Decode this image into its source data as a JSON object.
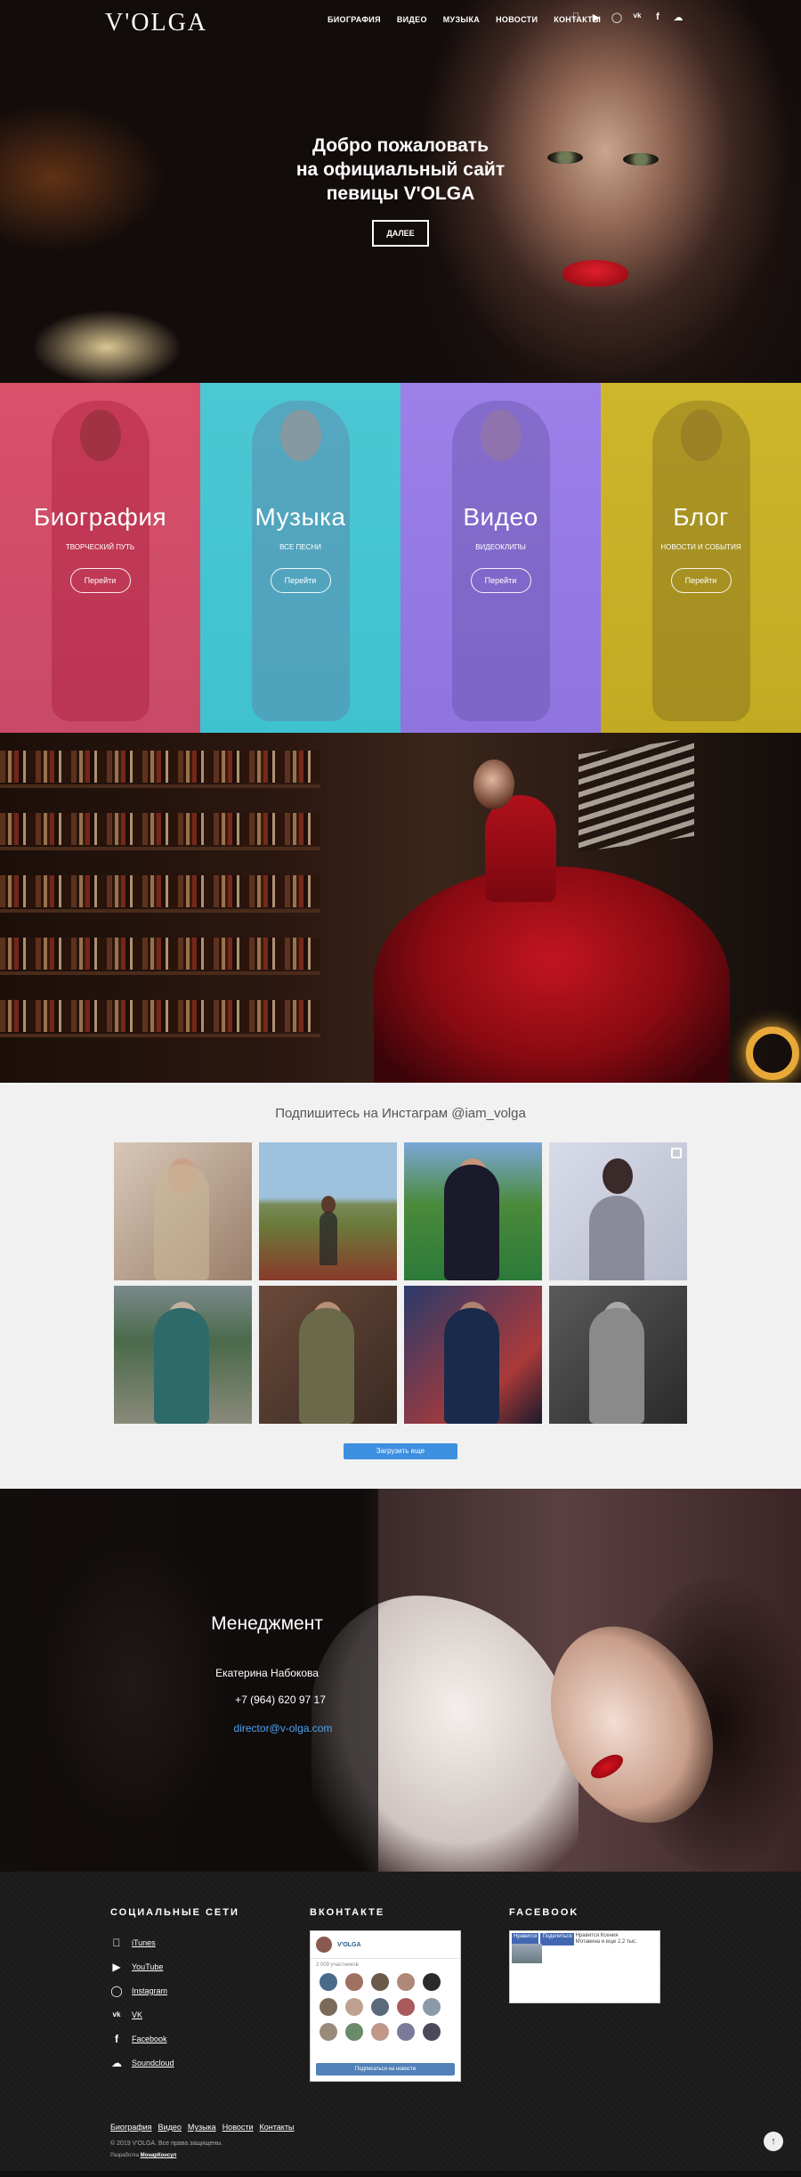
{
  "header": {
    "logo": "V'OLGA",
    "menu": [
      "БИОГРАФИЯ",
      "ВИДЕО",
      "МУЗЫКА",
      "НОВОСТИ",
      "КОНТАКТЫ"
    ],
    "social_icons": [
      "apple-icon",
      "youtube-icon",
      "instagram-icon",
      "vk-icon",
      "facebook-icon",
      "soundcloud-icon"
    ]
  },
  "hero": {
    "title_line1": "Добро пожаловать",
    "title_line2": "на официальный сайт",
    "title_line3": "певицы V'OLGA",
    "button": "ДАЛЕЕ"
  },
  "tiles": [
    {
      "title": "Биография",
      "subtitle": "ТВОРЧЕСКИЙ ПУТЬ",
      "button": "Перейти",
      "color": "#d8506a"
    },
    {
      "title": "Музыка",
      "subtitle": "ВСЕ ПЕСНИ",
      "button": "Перейти",
      "color": "#44c8d4"
    },
    {
      "title": "Видео",
      "subtitle": "ВИДЕОКЛИПЫ",
      "button": "Перейти",
      "color": "#9a7ee6"
    },
    {
      "title": "Блог",
      "subtitle": "НОВОСТИ И СОБЫТИЯ",
      "button": "Перейти",
      "color": "#cdb52a"
    }
  ],
  "instagram": {
    "heading": "Подпишитесь на Инстаграм @iam_volga",
    "load_more": "Загрузить еще"
  },
  "management": {
    "heading": "Менеджмент",
    "name": "Екатерина Набокова",
    "phone": "+7 (964) 620 97 17",
    "email": "director@v-olga.com"
  },
  "footer": {
    "social_heading": "СОЦИАЛЬНЫЕ СЕТИ",
    "social": [
      {
        "icon": "apple-icon",
        "label": "iTunes"
      },
      {
        "icon": "youtube-icon",
        "label": "YouTube"
      },
      {
        "icon": "instagram-icon",
        "label": "Instagram"
      },
      {
        "icon": "vk-icon",
        "label": "VK"
      },
      {
        "icon": "facebook-icon",
        "label": "Facebook"
      },
      {
        "icon": "soundcloud-icon",
        "label": "Soundcloud"
      }
    ],
    "vk_heading": "ВКОНТАКТЕ",
    "vk_widget": {
      "name": "V'OLGA",
      "count": "2 009 участников",
      "subscribe": "Подписаться на новости"
    },
    "fb_heading": "FACEBOOK",
    "fb_widget": {
      "like": "Нравится",
      "share": "Поделиться",
      "text": "Нравится Ксения Мотавина и еще 2,2 тыс."
    },
    "links": [
      "Биография",
      "Видео",
      "Музыка",
      "Новости",
      "Контакты"
    ],
    "copyright": "© 2019 V'OLGA. Все права защищены.",
    "developer_prefix": "Разработка",
    "developer": "МонарКонсул"
  }
}
